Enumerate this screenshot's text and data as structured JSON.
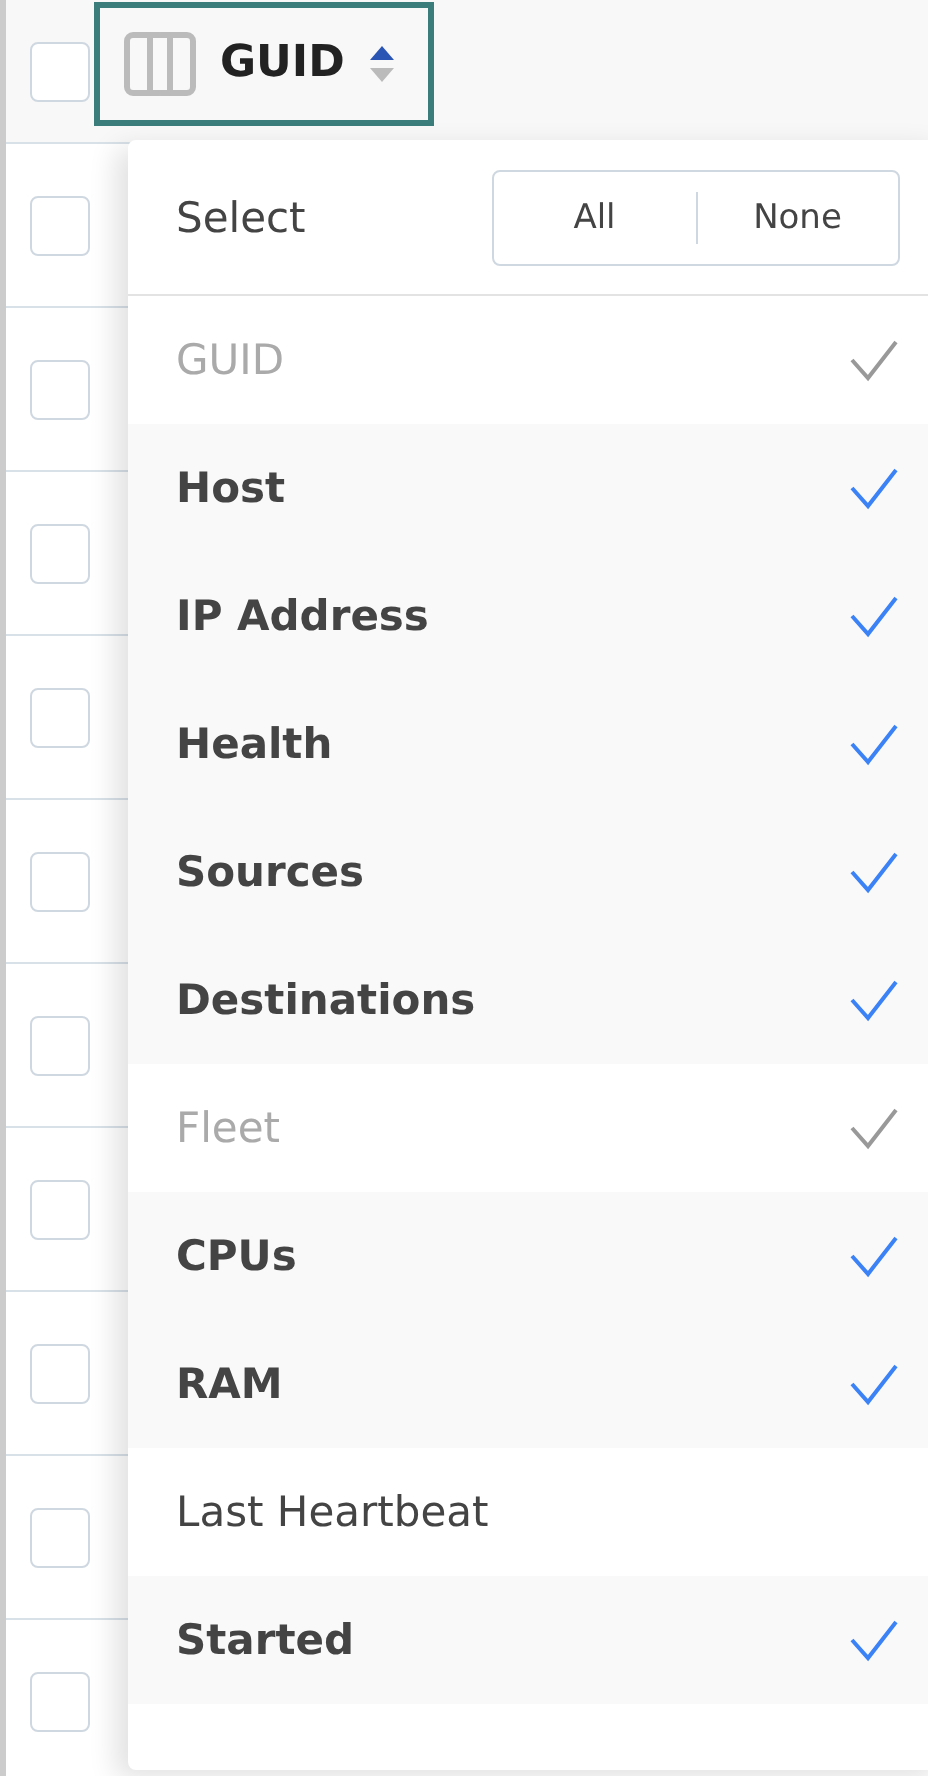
{
  "header": {
    "checked": false,
    "column_label": "GUID",
    "sort_ascending": true
  },
  "rows": [
    {
      "checked": false
    },
    {
      "checked": false
    },
    {
      "checked": false
    },
    {
      "checked": false
    },
    {
      "checked": false
    },
    {
      "checked": false
    },
    {
      "checked": false
    },
    {
      "checked": false
    },
    {
      "checked": false
    },
    {
      "checked": false
    }
  ],
  "column_menu": {
    "select_label": "Select",
    "buttons": [
      "All",
      "None"
    ],
    "items": [
      {
        "label": "GUID",
        "checked": true,
        "disabled": true
      },
      {
        "label": "Host",
        "checked": true,
        "disabled": false
      },
      {
        "label": "IP Address",
        "checked": true,
        "disabled": false
      },
      {
        "label": "Health",
        "checked": true,
        "disabled": false
      },
      {
        "label": "Sources",
        "checked": true,
        "disabled": false
      },
      {
        "label": "Destinations",
        "checked": true,
        "disabled": false
      },
      {
        "label": "Fleet",
        "checked": true,
        "disabled": true
      },
      {
        "label": "CPUs",
        "checked": true,
        "disabled": false
      },
      {
        "label": "RAM",
        "checked": true,
        "disabled": false
      },
      {
        "label": "Last Heartbeat",
        "checked": false,
        "disabled": false
      },
      {
        "label": "Started",
        "checked": true,
        "disabled": false
      }
    ]
  }
}
